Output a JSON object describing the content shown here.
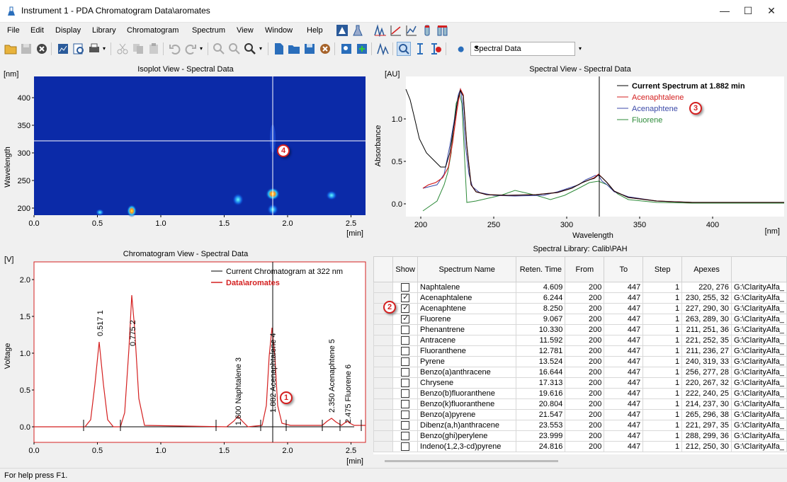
{
  "window": {
    "title": "Instrument 1 - PDA Chromatogram  Data\\aromates",
    "minimize": "—",
    "maximize": "☐",
    "close": "✕"
  },
  "menu": [
    "File",
    "Edit",
    "Display",
    "Library",
    "Chromatogram",
    "Spectrum",
    "View",
    "Window",
    "Help"
  ],
  "toolbar": {
    "combo_value": "Spectral Data"
  },
  "isoplot": {
    "title": "Isoplot View - Spectral Data",
    "y_unit": "[nm]",
    "y_label": "Wavelength",
    "x_unit": "[min]",
    "y_ticks": [
      "400",
      "350",
      "300",
      "250",
      "200"
    ],
    "x_ticks": [
      "0.0",
      "0.5",
      "1.0",
      "1.5",
      "2.0",
      "2.5"
    ],
    "marker": "4"
  },
  "spectral": {
    "title": "Spectral View - Spectral Data",
    "y_unit": "[AU]",
    "y_label": "Absorbance",
    "x_label": "Wavelength",
    "x_unit": "[nm]",
    "y_ticks": [
      "1.0",
      "0.5",
      "0.0"
    ],
    "x_ticks": [
      "200",
      "250",
      "300",
      "350",
      "400"
    ],
    "legend": [
      {
        "name": "Current Spectrum at 1.882 min",
        "color": "#000000"
      },
      {
        "name": "Acenaphtalene",
        "color": "#d42020"
      },
      {
        "name": "Acenaphtene",
        "color": "#3c4aa8"
      },
      {
        "name": "Fluorene",
        "color": "#2e8b3a"
      }
    ],
    "marker": "3"
  },
  "chromatogram": {
    "title": "Chromatogram View - Spectral Data",
    "y_unit": "[V]",
    "y_label": "Voltage",
    "x_unit": "[min]",
    "y_ticks": [
      "2.0",
      "1.5",
      "1.0",
      "0.5",
      "0.0"
    ],
    "x_ticks": [
      "0.0",
      "0.5",
      "1.0",
      "1.5",
      "2.0",
      "2.5"
    ],
    "legend": [
      {
        "name": "Current Chromatogram at 322 nm",
        "color": "#000000"
      },
      {
        "name": "Data\\aromates",
        "color": "#d42020"
      }
    ],
    "peak_labels": [
      {
        "text": "0.517   1"
      },
      {
        "text": "0.775   2"
      },
      {
        "text": "1.600 Naphtalene   3"
      },
      {
        "text": "1.882 Acenaphtalene   4"
      },
      {
        "text": "2.350 Acenaphtene   5"
      },
      {
        "text": "2.475 Fluorene   6"
      }
    ],
    "marker": "1"
  },
  "library": {
    "title": "Spectral Library: Calib\\PAH",
    "columns": [
      "Show",
      "Spectrum Name",
      "Reten. Time",
      "From",
      "To",
      "Step",
      "Apexes",
      ""
    ],
    "rows": [
      {
        "show": false,
        "name": "Naphtalene",
        "rt": "4.609",
        "from": "200",
        "to": "447",
        "step": "1",
        "apexes": "220, 276",
        "path": "G:\\ClarityAlfa_"
      },
      {
        "show": true,
        "name": "Acenaphtalene",
        "rt": "6.244",
        "from": "200",
        "to": "447",
        "step": "1",
        "apexes": "230, 255, 32",
        "path": "G:\\ClarityAlfa_"
      },
      {
        "show": true,
        "name": "Acenaphtene",
        "rt": "8.250",
        "from": "200",
        "to": "447",
        "step": "1",
        "apexes": "227, 290, 30",
        "path": "G:\\ClarityAlfa_"
      },
      {
        "show": true,
        "name": "Fluorene",
        "rt": "9.067",
        "from": "200",
        "to": "447",
        "step": "1",
        "apexes": "263, 289, 30",
        "path": "G:\\ClarityAlfa_"
      },
      {
        "show": false,
        "name": "Phenantrene",
        "rt": "10.330",
        "from": "200",
        "to": "447",
        "step": "1",
        "apexes": "211, 251, 36",
        "path": "G:\\ClarityAlfa_"
      },
      {
        "show": false,
        "name": "Antracene",
        "rt": "11.592",
        "from": "200",
        "to": "447",
        "step": "1",
        "apexes": "221, 252, 35",
        "path": "G:\\ClarityAlfa_"
      },
      {
        "show": false,
        "name": "Fluoranthene",
        "rt": "12.781",
        "from": "200",
        "to": "447",
        "step": "1",
        "apexes": "211, 236, 27",
        "path": "G:\\ClarityAlfa_"
      },
      {
        "show": false,
        "name": "Pyrene",
        "rt": "13.524",
        "from": "200",
        "to": "447",
        "step": "1",
        "apexes": "240, 319, 33",
        "path": "G:\\ClarityAlfa_"
      },
      {
        "show": false,
        "name": "Benzo(a)anthracene",
        "rt": "16.644",
        "from": "200",
        "to": "447",
        "step": "1",
        "apexes": "256, 277, 28",
        "path": "G:\\ClarityAlfa_"
      },
      {
        "show": false,
        "name": "Chrysene",
        "rt": "17.313",
        "from": "200",
        "to": "447",
        "step": "1",
        "apexes": "220, 267, 32",
        "path": "G:\\ClarityAlfa_"
      },
      {
        "show": false,
        "name": "Benzo(b)fluoranthene",
        "rt": "19.616",
        "from": "200",
        "to": "447",
        "step": "1",
        "apexes": "222, 240, 25",
        "path": "G:\\ClarityAlfa_"
      },
      {
        "show": false,
        "name": "Benzo(k)fluoranthene",
        "rt": "20.804",
        "from": "200",
        "to": "447",
        "step": "1",
        "apexes": "214, 237, 30",
        "path": "G:\\ClarityAlfa_"
      },
      {
        "show": false,
        "name": "Benzo(a)pyrene",
        "rt": "21.547",
        "from": "200",
        "to": "447",
        "step": "1",
        "apexes": "265, 296, 38",
        "path": "G:\\ClarityAlfa_"
      },
      {
        "show": false,
        "name": "Dibenz(a,h)anthracene",
        "rt": "23.553",
        "from": "200",
        "to": "447",
        "step": "1",
        "apexes": "221, 297, 35",
        "path": "G:\\ClarityAlfa_"
      },
      {
        "show": false,
        "name": "Benzo(ghi)perylene",
        "rt": "23.999",
        "from": "200",
        "to": "447",
        "step": "1",
        "apexes": "288, 299, 36",
        "path": "G:\\ClarityAlfa_"
      },
      {
        "show": false,
        "name": "Indeno(1,2,3-cd)pyrene",
        "rt": "24.816",
        "from": "200",
        "to": "447",
        "step": "1",
        "apexes": "212, 250, 30",
        "path": "G:\\ClarityAlfa_"
      }
    ],
    "marker": "2"
  },
  "status": {
    "text": "For help press F1."
  }
}
